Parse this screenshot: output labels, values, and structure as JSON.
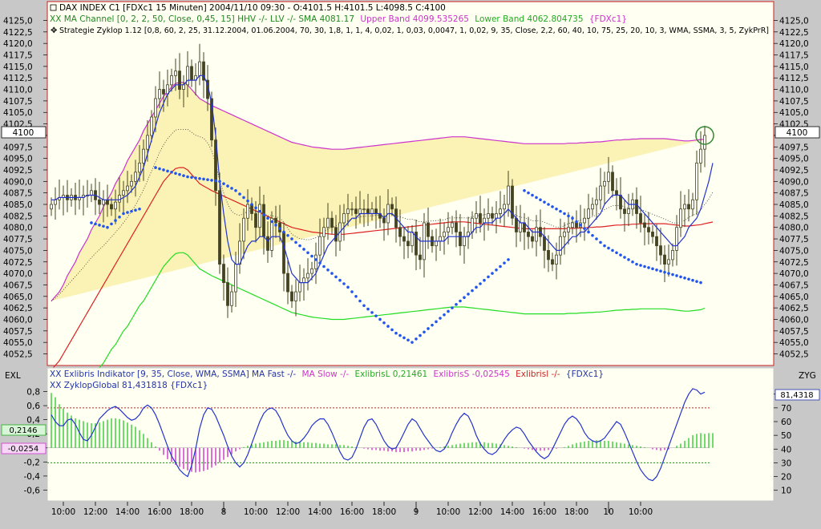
{
  "colors": {
    "background": "#fffff2",
    "frame": "#c8c8c8",
    "band_fill": "#fbf3b6",
    "upper_band": "#cc33cc",
    "lower_band": "#22dd22",
    "sma": "#dd2222",
    "ma_fast": "#2233cc",
    "zyklop_dots": "#2255ee",
    "hist_pos": "#33cc33",
    "hist_neg": "#cc33cc",
    "ref_upper": "#cc2222",
    "ref_lower": "#119911",
    "candle": "#444422",
    "price_flag": "#ffffff",
    "highlight_circle": "#338833"
  },
  "legend": {
    "line1": "DAX INDEX C1 [FDXc1  15 Minuten] 2004/11/10 09:30 - O:4101.5 H:4101.5 L:4098.5 C:4100",
    "line2_a": "XX MA Channel [0, 2, 2, 50, Close, 0,45, 15] HHV -/- LLV -/- SMA 4081.17",
    "line2_b": "Upper Band 4099.535265",
    "line2_c": "Lower Band 4062.804735",
    "line2_d": "{FDXc1}",
    "line3": "Strategie Zyklop 1.12 [0,8, 60, 2, 25, 31.12.2004, 01.06.2004, 70, 30, 1,8, 1, 1, 4, 0,02, 1, 0,03, 0,0047, 1, 0,02, 9, 35, Close, 2,2, 60, 40, 10, 75, 25, 20, 10, 3, WMA, SSMA, 3, 5, ZykPrR]",
    "lower1_a": "XX Exlibris Indikator [9, 35, Close, WMA, SSMA] MA Fast -/-",
    "lower1_b": "MA Slow -/-",
    "lower1_c": "ExlibrisL 0,21461",
    "lower1_d": "ExlibrisS -0,02545",
    "lower1_e": "Exlibrisl -/-",
    "lower1_f": "{FDXc1}",
    "lower2": "XX ZyklopGlobal 81,431818 {FDXc1}"
  },
  "labels": {
    "left_pane": "EXL",
    "right_pane": "ZYG",
    "current_price": "4100",
    "exl_pos": "0,2146",
    "exl_neg": "-0,0254",
    "zyg_value": "81,4318"
  },
  "chart_data": [
    {
      "type": "candlestick",
      "x_ticks": [
        "10:00",
        "12:00",
        "14:00",
        "16:00",
        "18:00",
        "8",
        "10:00",
        "12:00",
        "14:00",
        "16:00",
        "18:00",
        "9",
        "10:00",
        "12:00",
        "14:00",
        "16:00",
        "18:00",
        "10",
        "10:00"
      ],
      "y_ticks": [
        "4125,0",
        "4122,5",
        "4120,0",
        "4117,5",
        "4115,0",
        "4112,5",
        "4110,0",
        "4107,5",
        "4105,0",
        "4102,5",
        "4100",
        "4097,5",
        "4095,0",
        "4092,5",
        "4090,0",
        "4087,5",
        "4085,0",
        "4082,5",
        "4080,0",
        "4077,5",
        "4075,0",
        "4072,5",
        "4070,0",
        "4067,5",
        "4065,0",
        "4062,5",
        "4060,0",
        "4057,5",
        "4055,0",
        "4052,5"
      ],
      "ylim": [
        4050.5,
        4127
      ],
      "n_bars": 164,
      "last_bar": {
        "open": 4101.5,
        "high": 4101.5,
        "low": 4098.5,
        "close": 4100
      },
      "close": [
        4085,
        4086,
        4086.5,
        4087,
        4086,
        4087,
        4086,
        4086.5,
        4087,
        4087,
        4088,
        4086,
        4085,
        4086,
        4085,
        4084,
        4085.5,
        4087,
        4088,
        4089,
        4090,
        4092,
        4094,
        4097,
        4100,
        4104,
        4108,
        4110,
        4109,
        4111,
        4113,
        4114,
        4110,
        4111,
        4115,
        4112,
        4113,
        4116,
        4112,
        4108,
        4099,
        4088,
        4072,
        4068,
        4063,
        4066,
        4072,
        4077,
        4082,
        4085,
        4083,
        4080,
        4085,
        4078,
        4075,
        4082,
        4081,
        4079,
        4070,
        4066,
        4064,
        4066,
        4068,
        4069,
        4070,
        4071,
        4074,
        4078,
        4080,
        4082,
        4080,
        4077,
        4081,
        4083,
        4084,
        4084,
        4083,
        4084,
        4084,
        4083,
        4084,
        4083,
        4082,
        4081,
        4085,
        4084,
        4080,
        4078,
        4077,
        4076,
        4079,
        4074,
        4073,
        4081,
        4078,
        4076,
        4077,
        4078,
        4079,
        4080,
        4081,
        4079,
        4076,
        4078,
        4079,
        4082,
        4083,
        4081,
        4082,
        4083,
        4082,
        4083,
        4084,
        4085,
        4089,
        4082,
        4079,
        4081,
        4079,
        4078,
        4077,
        4080,
        4078,
        4075,
        4073,
        4072,
        4074,
        4078,
        4079,
        4080,
        4081,
        4080,
        4081,
        4082,
        4084,
        4085,
        4086,
        4089,
        4090,
        4092,
        4088,
        4087,
        4084,
        4083,
        4084,
        4086,
        4083,
        4081,
        4080,
        4079,
        4078,
        4076,
        4074,
        4072,
        4073,
        4075,
        4080,
        4084,
        4085,
        4084,
        4086,
        4094,
        4097,
        4100
      ],
      "ma_fast": [
        4086,
        4086,
        4086.5,
        4086.5,
        4086.5,
        4086.5,
        4086.5,
        4086.5,
        4086.5,
        4087,
        4087,
        4087,
        4086.5,
        4086,
        4086,
        4086,
        4086,
        4086,
        4086.5,
        4087,
        4088,
        4089,
        4091,
        4093,
        4096,
        4099,
        4102,
        4105,
        4107,
        4109,
        4110,
        4111,
        4111,
        4111,
        4112,
        4112,
        4112,
        4113,
        4113,
        4111,
        4107,
        4100,
        4090,
        4083,
        4077,
        4073,
        4072,
        4072,
        4074,
        4076,
        4077,
        4077,
        4078,
        4078,
        4077,
        4078,
        4078,
        4078,
        4076,
        4073,
        4070,
        4069,
        4068,
        4068,
        4068,
        4069,
        4070,
        4072,
        4074,
        4076,
        4077,
        4078,
        4079,
        4080,
        4081,
        4082,
        4082,
        4083,
        4083,
        4083,
        4083,
        4083,
        4083,
        4082,
        4083,
        4083,
        4082,
        4081,
        4080,
        4079,
        4079,
        4078,
        4077,
        4077,
        4077,
        4077,
        4077,
        4077,
        4077,
        4078,
        4078,
        4078,
        4078,
        4078,
        4078,
        4079,
        4080,
        4080,
        4081,
        4081,
        4081,
        4082,
        4082,
        4083,
        4084,
        4083,
        4082,
        4081,
        4081,
        4080,
        4079,
        4079,
        4079,
        4078,
        4077,
        4076,
        4075,
        4075,
        4076,
        4077,
        4078,
        4078,
        4079,
        4079,
        4080,
        4081,
        4082,
        4083,
        4085,
        4086,
        4087,
        4087,
        4087,
        4086,
        4085,
        4085,
        4085,
        4084,
        4083,
        4082,
        4081,
        4080,
        4079,
        4078,
        4077,
        4076,
        4076,
        4077,
        4078,
        4080,
        4081,
        4082,
        4084,
        4087,
        4090,
        4094
      ],
      "sma_line": [
        4049,
        4050,
        4051,
        4052.5,
        4054,
        4055.5,
        4057,
        4058.5,
        4060,
        4061.5,
        4063,
        4064.5,
        4066,
        4067.5,
        4069,
        4070.5,
        4072,
        4073.5,
        4075,
        4076.5,
        4078,
        4079.5,
        4081,
        4082.5,
        4084,
        4085.5,
        4087,
        4088.5,
        4090,
        4091,
        4092,
        4092.8,
        4093,
        4093,
        4092.5,
        4091.5,
        4090.5,
        4089.5,
        4089,
        4088.5,
        4088,
        4087.6,
        4087.2,
        4086.8,
        4086.4,
        4086,
        4085.6,
        4085.2,
        4084.8,
        4084.4,
        4084,
        4083.6,
        4083.2,
        4082.8,
        4082.4,
        4082,
        4081.6,
        4081.2,
        4080.8,
        4080.4,
        4080,
        4079.8,
        4079.6,
        4079.4,
        4079.2,
        4079,
        4078.9,
        4078.8,
        4078.7,
        4078.6,
        4078.5,
        4078.5,
        4078.5,
        4078.5,
        4078.6,
        4078.7,
        4078.8,
        4078.9,
        4079,
        4079.1,
        4079.2,
        4079.3,
        4079.4,
        4079.5,
        4079.6,
        4079.7,
        4079.8,
        4079.9,
        4080,
        4080.1,
        4080.2,
        4080.3,
        4080.4,
        4080.5,
        4080.6,
        4080.7,
        4080.8,
        4080.9,
        4081,
        4081.1,
        4081.2,
        4081.2,
        4081.2,
        4081.2,
        4081.1,
        4081,
        4080.9,
        4080.8,
        4080.7,
        4080.6,
        4080.5,
        4080.4,
        4080.3,
        4080.2,
        4080.1,
        4080,
        4079.9,
        4079.8,
        4079.7,
        4079.7,
        4079.7,
        4079.7,
        4079.7,
        4079.7,
        4079.7,
        4079.7,
        4079.7,
        4079.7,
        4079.7,
        4079.8,
        4079.8,
        4079.8,
        4079.9,
        4079.9,
        4080,
        4080,
        4080.1,
        4080.1,
        4080.2,
        4080.3,
        4080.4,
        4080.5,
        4080.5,
        4080.6,
        4080.6,
        4080.7,
        4080.7,
        4080.8,
        4080.8,
        4080.8,
        4080.8,
        4080.8,
        4080.8,
        4080.8,
        4080.7,
        4080.6,
        4080.5,
        4080.4,
        4080.3,
        4080.3,
        4080.4,
        4080.5,
        4080.6,
        4080.8,
        4081,
        4081.17
      ],
      "band_half_width": [
        15,
        15,
        15,
        15,
        15.5,
        15.5,
        15.5,
        16,
        16,
        16,
        16.5,
        16.5,
        16.5,
        17,
        17,
        17,
        17.5,
        17.5,
        17.5,
        18,
        18,
        18,
        18,
        18.5,
        18.5,
        18.5,
        18.5,
        18.5,
        18.5,
        18.5,
        18.5,
        18.5,
        18.5,
        18.5,
        18.5,
        18.5,
        18.5,
        18.5,
        18.5,
        18.5,
        18.5,
        18.5,
        18.5,
        18.5,
        18.5,
        18.5,
        18.5,
        18.5,
        18.5,
        18.5,
        18.5,
        18.5,
        18.5,
        18.5,
        18.5,
        18.5,
        18.5,
        18.5,
        18.5,
        18.5,
        18.5,
        18.5,
        18.5,
        18.5,
        18.5,
        18.5,
        18.5,
        18.5,
        18.5,
        18.5,
        18.5,
        18.5,
        18.5,
        18.5,
        18.5,
        18.5,
        18.5,
        18.5,
        18.5,
        18.5,
        18.5,
        18.5,
        18.5,
        18.5,
        18.5,
        18.5,
        18.5,
        18.5,
        18.5,
        18.5,
        18.5,
        18.5,
        18.5,
        18.5,
        18.5,
        18.5,
        18.5,
        18.5,
        18.5,
        18.5,
        18.5,
        18.5,
        18.5,
        18.5,
        18.5,
        18.5,
        18.5,
        18.5,
        18.5,
        18.5,
        18.5,
        18.5,
        18.5,
        18.5,
        18.5,
        18.5,
        18.5,
        18.5,
        18.5,
        18.5,
        18.5,
        18.5,
        18.5,
        18.5,
        18.5,
        18.5,
        18.5,
        18.5,
        18.5,
        18.5,
        18.5,
        18.5,
        18.5,
        18.5,
        18.5,
        18.5,
        18.5,
        18.5,
        18.5,
        18.5,
        18.5,
        18.5,
        18.5,
        18.5,
        18.5,
        18.5,
        18.5,
        18.5,
        18.5,
        18.5,
        18.5,
        18.5,
        18.5,
        18.5,
        18.5,
        18.5,
        18.5,
        18.5,
        18.5,
        18.5,
        18.5,
        18.5,
        18.5,
        18.37
      ],
      "zyklop_dots": [
        [
          10,
          4081
        ],
        [
          14,
          4080
        ],
        [
          18,
          4083
        ],
        [
          22,
          4084
        ],
        [
          26,
          4093
        ],
        [
          30,
          4092
        ],
        [
          34,
          4091
        ],
        [
          38,
          4090.5
        ],
        [
          42,
          4090
        ],
        [
          46,
          4088
        ],
        [
          50,
          4085
        ],
        [
          54,
          4082
        ],
        [
          58,
          4079
        ],
        [
          62,
          4076
        ],
        [
          66,
          4073
        ],
        [
          70,
          4070
        ],
        [
          74,
          4067
        ],
        [
          78,
          4063
        ],
        [
          82,
          4060
        ],
        [
          86,
          4057
        ],
        [
          90,
          4055
        ],
        [
          94,
          4058
        ],
        [
          98,
          4061
        ],
        [
          102,
          4064
        ],
        [
          106,
          4067
        ],
        [
          110,
          4070
        ],
        [
          114,
          4073
        ],
        [
          118,
          4088
        ],
        [
          122,
          4086
        ],
        [
          126,
          4084
        ],
        [
          130,
          4082
        ],
        [
          134,
          4079
        ],
        [
          138,
          4076
        ],
        [
          142,
          4074
        ],
        [
          146,
          4072
        ],
        [
          150,
          4071
        ],
        [
          154,
          4070
        ],
        [
          158,
          4069
        ],
        [
          162,
          4068
        ]
      ],
      "series": [
        {
          "name": "Upper Band",
          "value": 4099.535265
        },
        {
          "name": "Lower Band",
          "value": 4062.804735
        },
        {
          "name": "SMA",
          "value": 4081.17
        }
      ]
    },
    {
      "type": "histogram",
      "pane": "EXL",
      "y_ticks": [
        "0,8",
        "0,6",
        "0,4",
        "0,2",
        "0",
        "-0,2",
        "-0,4",
        "-0,6"
      ],
      "ylim": [
        -0.72,
        0.92
      ],
      "series": [
        {
          "name": "ExlibrisL",
          "value": 0.21461
        },
        {
          "name": "ExlibrisS",
          "value": -0.02545
        }
      ],
      "values": [
        0.78,
        0.72,
        0.62,
        0.56,
        0.5,
        0.46,
        0.42,
        0.4,
        0.38,
        0.36,
        0.35,
        0.35,
        0.36,
        0.38,
        0.4,
        0.42,
        0.42,
        0.41,
        0.39,
        0.36,
        0.33,
        0.3,
        0.25,
        0.2,
        0.14,
        0.08,
        0.02,
        -0.04,
        -0.1,
        -0.16,
        -0.2,
        -0.24,
        -0.27,
        -0.3,
        -0.32,
        -0.34,
        -0.35,
        -0.34,
        -0.33,
        -0.31,
        -0.28,
        -0.25,
        -0.21,
        -0.17,
        -0.13,
        -0.09,
        -0.05,
        -0.02,
        0.01,
        0.03,
        0.05,
        0.06,
        0.07,
        0.08,
        0.09,
        0.1,
        0.1,
        0.11,
        0.11,
        0.1,
        0.1,
        0.09,
        0.09,
        0.08,
        0.08,
        0.07,
        0.07,
        0.06,
        0.06,
        0.05,
        0.05,
        0.05,
        0.04,
        0.04,
        0.03,
        0.02,
        0.01,
        0,
        -0.01,
        -0.02,
        -0.03,
        -0.03,
        -0.04,
        -0.04,
        -0.05,
        -0.05,
        -0.06,
        -0.06,
        -0.06,
        -0.05,
        -0.05,
        -0.04,
        -0.04,
        -0.03,
        -0.02,
        -0.01,
        0,
        0.01,
        0.02,
        0.03,
        0.04,
        0.05,
        0.06,
        0.07,
        0.07,
        0.08,
        0.08,
        0.08,
        0.08,
        0.07,
        0.07,
        0.06,
        0.05,
        0.04,
        0.03,
        0.02,
        0.01,
        0,
        -0.01,
        -0.02,
        -0.03,
        -0.04,
        -0.04,
        -0.04,
        -0.03,
        -0.02,
        -0.01,
        0,
        0.01,
        0.03,
        0.05,
        0.07,
        0.08,
        0.09,
        0.1,
        0.1,
        0.11,
        0.11,
        0.1,
        0.1,
        0.09,
        0.08,
        0.07,
        0.06,
        0.05,
        0.04,
        0.03,
        0.02,
        0.01,
        0,
        -0.02,
        -0.03,
        -0.04,
        -0.03,
        -0.02,
        0,
        0.03,
        0.06,
        0.1,
        0.14,
        0.18,
        0.2,
        0.21,
        0.2,
        0.21,
        0.21
      ]
    },
    {
      "type": "line",
      "pane": "ZYG",
      "y_ticks": [
        "80",
        "70",
        "60",
        "50",
        "40",
        "30",
        "20",
        "10"
      ],
      "ylim": [
        4,
        88
      ],
      "reference_lines": [
        70,
        30
      ],
      "series": [
        {
          "name": "ZyklopGlobal",
          "value": 81.431818
        }
      ],
      "values": [
        65,
        60,
        57,
        57,
        61,
        62,
        58,
        52,
        47,
        46,
        50,
        56,
        62,
        65,
        68,
        70,
        71,
        69,
        66,
        63,
        61,
        62,
        65,
        70,
        72,
        70,
        65,
        58,
        50,
        42,
        35,
        30,
        25,
        22,
        20,
        28,
        40,
        55,
        65,
        70,
        69,
        64,
        57,
        50,
        42,
        35,
        30,
        27,
        30,
        36,
        44,
        52,
        60,
        66,
        69,
        70,
        68,
        63,
        56,
        50,
        46,
        44,
        45,
        48,
        52,
        57,
        60,
        62,
        62,
        58,
        52,
        45,
        38,
        33,
        32,
        34,
        40,
        48,
        56,
        61,
        62,
        58,
        52,
        46,
        42,
        40,
        41,
        46,
        52,
        58,
        62,
        60,
        55,
        50,
        46,
        42,
        39,
        38,
        40,
        45,
        52,
        58,
        63,
        66,
        64,
        58,
        50,
        44,
        40,
        37,
        36,
        38,
        42,
        47,
        51,
        54,
        56,
        55,
        51,
        46,
        42,
        38,
        35,
        33,
        35,
        40,
        46,
        52,
        58,
        62,
        64,
        62,
        58,
        52,
        48,
        46,
        45,
        46,
        48,
        52,
        56,
        60,
        58,
        52,
        45,
        38,
        31,
        25,
        21,
        18,
        17,
        20,
        26,
        34,
        42,
        50,
        58,
        66,
        74,
        80,
        84,
        83,
        80,
        81.43
      ]
    }
  ]
}
